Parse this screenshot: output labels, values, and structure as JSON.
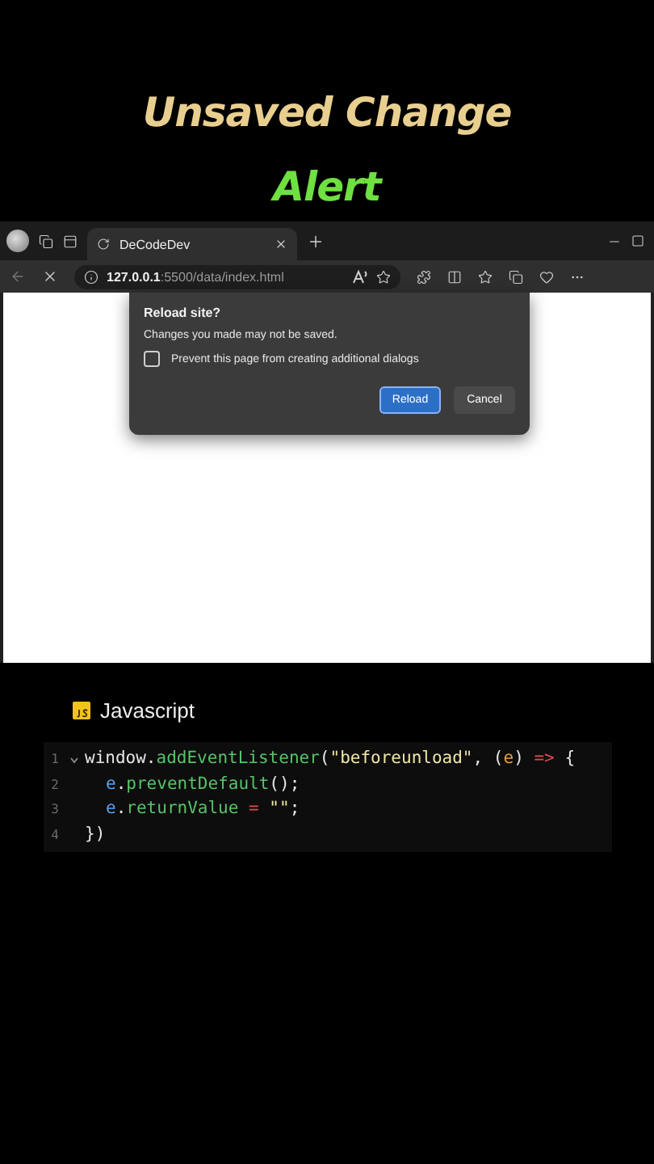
{
  "heading": {
    "line_1": "Unsaved Change",
    "line_2": "Alert"
  },
  "browser": {
    "tab": {
      "title": "DeCodeDev",
      "loading": true
    },
    "address": {
      "host": "127.0.0.1",
      "path": ":5500/data/index.html"
    },
    "dialog": {
      "title": "Reload site?",
      "message": "Changes you made may not be saved.",
      "option": {
        "label": "Prevent this page from creating additional dialogs",
        "checked": false
      },
      "buttons": [
        {
          "label": "Reload",
          "kind": "primary"
        },
        {
          "label": "Cancel",
          "kind": "secondary"
        }
      ]
    }
  },
  "code_panel": {
    "language": "Javascript",
    "lines": [
      {
        "number": "1",
        "kind": "top",
        "foldable": true,
        "tokens": [
          {
            "text": "window.",
            "kind": "plain"
          },
          {
            "text": "addEventListener",
            "kind": "function"
          },
          {
            "text": "(",
            "kind": "plain"
          },
          {
            "text": "\"beforeunload\"",
            "kind": "string"
          },
          {
            "text": ", (",
            "kind": "plain"
          },
          {
            "text": "e",
            "kind": "param"
          },
          {
            "text": ") ",
            "kind": "plain"
          },
          {
            "text": "=>",
            "kind": "keyword"
          },
          {
            "text": " {",
            "kind": "plain"
          }
        ]
      },
      {
        "number": "2",
        "kind": "body",
        "foldable": false,
        "tokens": [
          {
            "text": "e",
            "kind": "variable"
          },
          {
            "text": ".",
            "kind": "plain"
          },
          {
            "text": "preventDefault",
            "kind": "function"
          },
          {
            "text": "();",
            "kind": "plain"
          }
        ]
      },
      {
        "number": "3",
        "kind": "body",
        "foldable": false,
        "tokens": [
          {
            "text": "e",
            "kind": "variable"
          },
          {
            "text": ".",
            "kind": "plain"
          },
          {
            "text": "returnValue",
            "kind": "function"
          },
          {
            "text": " = ",
            "kind": "keyword"
          },
          {
            "text": "\"\"",
            "kind": "string"
          },
          {
            "text": ";",
            "kind": "plain"
          }
        ]
      },
      {
        "number": "4",
        "kind": "top",
        "foldable": false,
        "tokens": [
          {
            "text": "})",
            "kind": "plain"
          }
        ]
      }
    ]
  }
}
